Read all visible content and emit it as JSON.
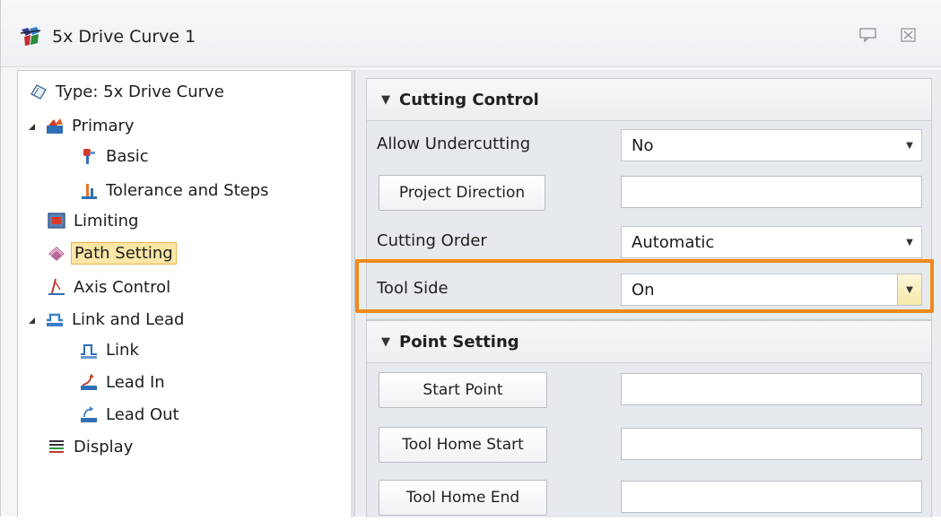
{
  "window": {
    "title": "5x Drive Curve 1",
    "accent_color": "#f08a1c",
    "selected_bg": "#fde7a6"
  },
  "tree": {
    "items": [
      {
        "label": "Type: 5x Drive Curve",
        "icon": "type-icon"
      },
      {
        "label": "Primary",
        "icon": "primary-icon",
        "expanded": true
      },
      {
        "label": "Basic",
        "icon": "basic-icon"
      },
      {
        "label": "Tolerance and Steps",
        "icon": "tolerance-icon"
      },
      {
        "label": "Limiting",
        "icon": "limiting-icon"
      },
      {
        "label": "Path Setting",
        "icon": "path-setting-icon",
        "selected": true
      },
      {
        "label": "Axis Control",
        "icon": "axis-control-icon"
      },
      {
        "label": "Link and Lead",
        "icon": "link-lead-icon",
        "expanded": true
      },
      {
        "label": "Link",
        "icon": "link-icon"
      },
      {
        "label": "Lead In",
        "icon": "lead-in-icon"
      },
      {
        "label": "Lead Out",
        "icon": "lead-out-icon"
      },
      {
        "label": "Display",
        "icon": "display-icon"
      }
    ]
  },
  "cutting_control": {
    "title": "Cutting Control",
    "allow_undercutting": {
      "label": "Allow Undercutting",
      "value": "No"
    },
    "project_direction": {
      "label": "Project Direction",
      "value": ""
    },
    "cutting_order": {
      "label": "Cutting Order",
      "value": "Automatic"
    },
    "tool_side": {
      "label": "Tool Side",
      "value": "On"
    }
  },
  "point_setting": {
    "title": "Point Setting",
    "start_point": {
      "label": "Start Point",
      "value": ""
    },
    "tool_home_start": {
      "label": "Tool Home Start",
      "value": ""
    },
    "tool_home_end": {
      "label": "Tool Home End",
      "value": ""
    }
  }
}
